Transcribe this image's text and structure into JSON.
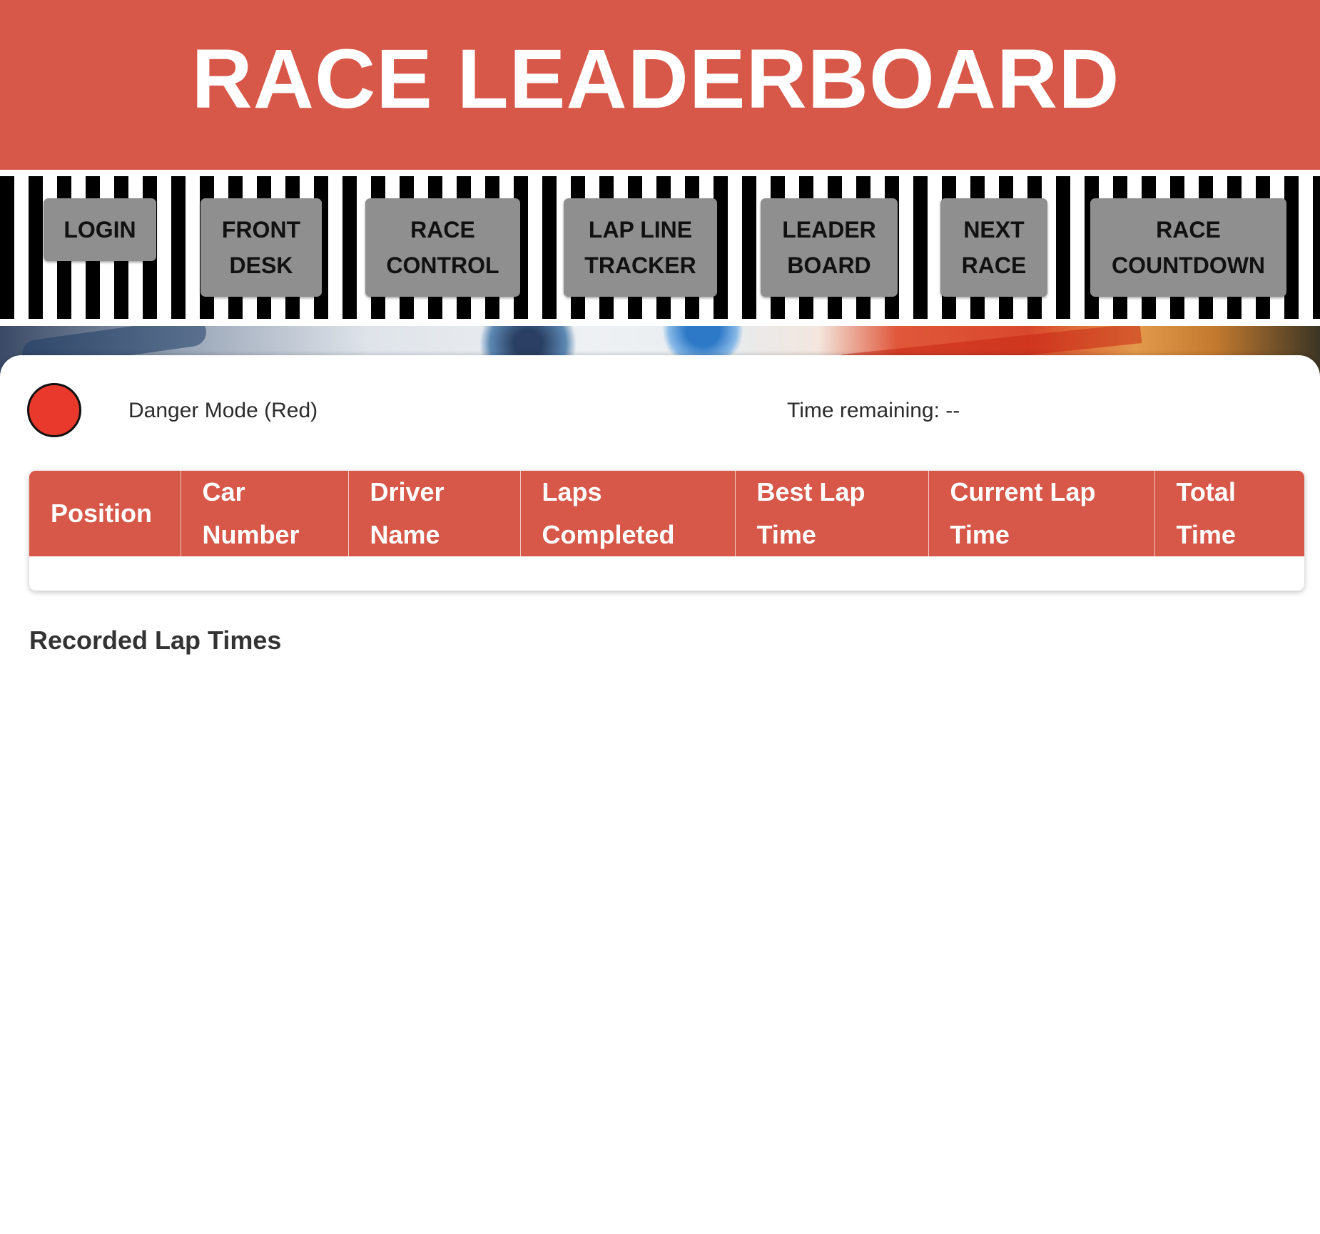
{
  "header": {
    "title": "RACE LEADERBOARD"
  },
  "nav": {
    "items": [
      {
        "label": "LOGIN"
      },
      {
        "label": "FRONT\nDESK"
      },
      {
        "label": "RACE\nCONTROL"
      },
      {
        "label": "LAP LINE\nTRACKER"
      },
      {
        "label": "LEADER\nBOARD"
      },
      {
        "label": "NEXT\nRACE"
      },
      {
        "label": "RACE\nCOUNTDOWN"
      }
    ]
  },
  "status": {
    "mode_label": "Danger Mode (Red)",
    "mode_color": "#e8392c",
    "time_remaining": "Time remaining: --"
  },
  "leaderboard": {
    "columns": [
      "Position",
      "Car Number",
      "Driver Name",
      "Laps Completed",
      "Best Lap Time",
      "Current Lap Time",
      "Total Time"
    ],
    "rows": []
  },
  "recorded": {
    "title": "Recorded Lap Times"
  },
  "colors": {
    "accent": "#d75748",
    "button_gray": "#8f8f8f"
  }
}
